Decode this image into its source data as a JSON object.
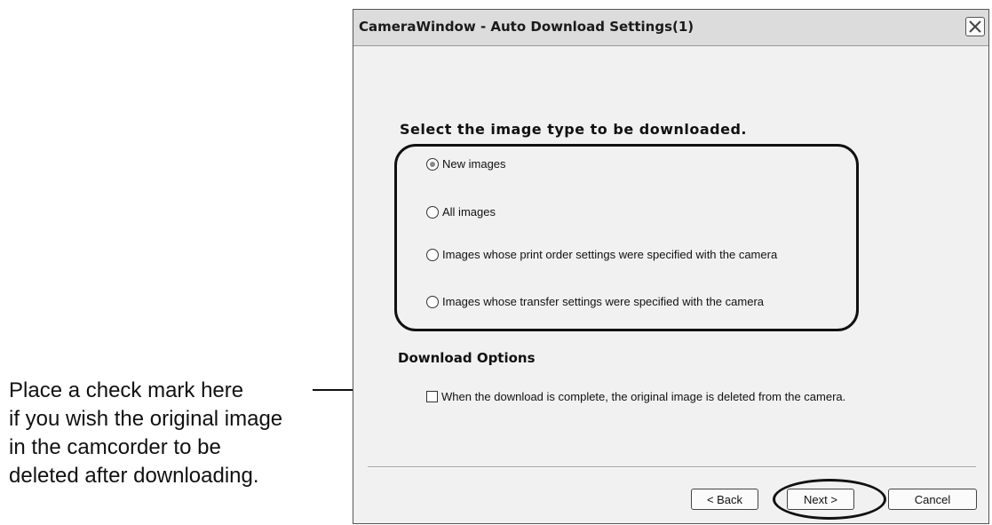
{
  "dialog": {
    "title": "CameraWindow - Auto Download Settings(1)",
    "heading": "Select the image type to be downloaded.",
    "image_types": [
      {
        "label": "New images",
        "selected": true
      },
      {
        "label": "All images",
        "selected": false
      },
      {
        "label": "Images whose print order settings were specified with the camera",
        "selected": false
      },
      {
        "label": "Images whose transfer settings were specified with the camera",
        "selected": false
      }
    ],
    "download_options": {
      "heading": "Download Options",
      "delete_after_download": {
        "label": "When the download is complete, the original image is deleted from the camera.",
        "checked": false
      }
    },
    "buttons": {
      "back": "< Back",
      "next": "Next >",
      "cancel": "Cancel"
    }
  },
  "callout": {
    "lines": [
      "Place a check mark here",
      "if you wish the original image",
      "in the camcorder to be",
      "deleted after downloading."
    ]
  },
  "icons": {
    "close": "close-icon"
  }
}
